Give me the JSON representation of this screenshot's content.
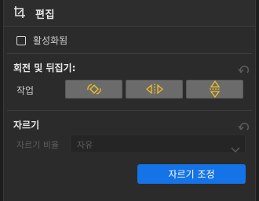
{
  "header": {
    "title": "편집",
    "icon": "crop-edit-icon"
  },
  "enable": {
    "label": "활성화됨",
    "checked": false
  },
  "rotate_flip": {
    "title": "회전 및 뒤집기:",
    "row_label": "작업",
    "buttons": [
      {
        "icon": "rotate-icon"
      },
      {
        "icon": "flip-horizontal-icon"
      },
      {
        "icon": "flip-vertical-icon"
      }
    ]
  },
  "crop": {
    "title": "자르기",
    "ratio_label": "자르기 비율",
    "ratio_value": "자유",
    "adjust_button": "자르기 조정"
  },
  "colors": {
    "accent": "#1473e6",
    "icon_yellow": "#f0c020"
  }
}
